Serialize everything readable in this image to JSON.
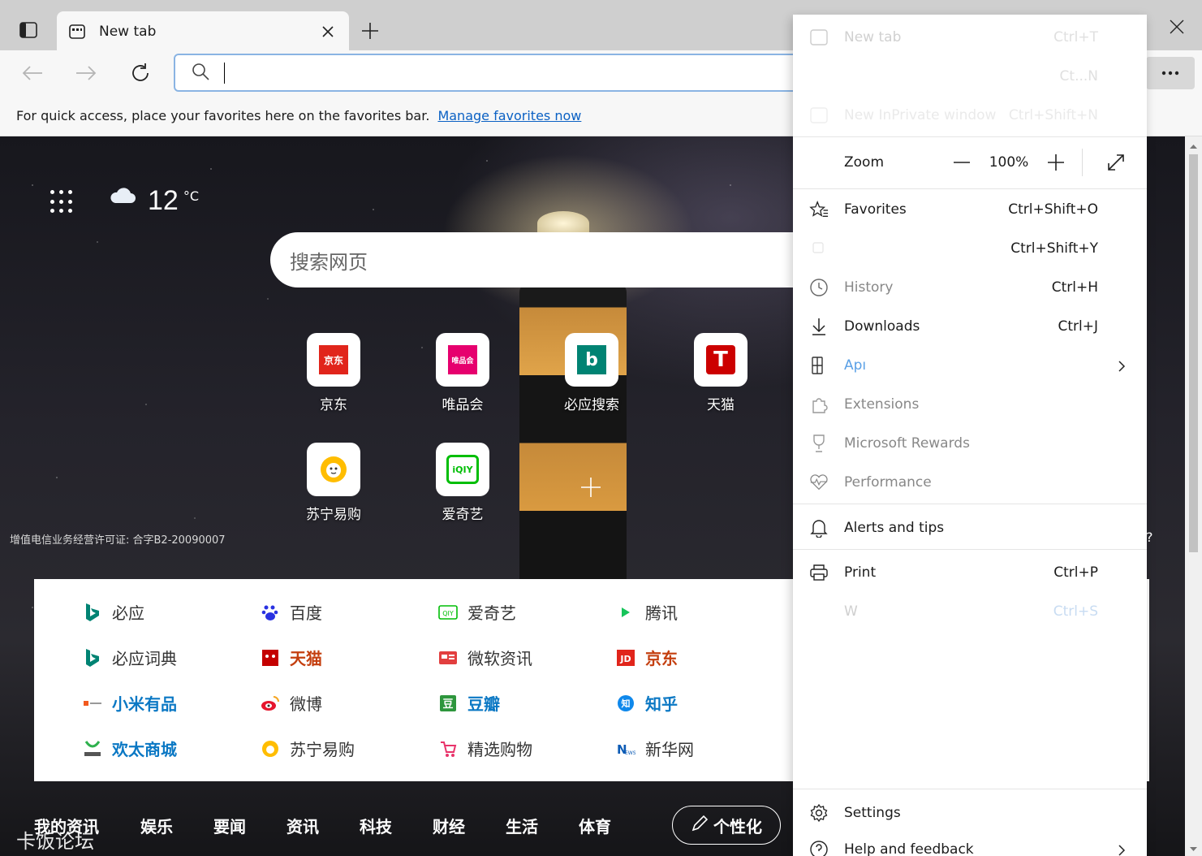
{
  "tab": {
    "title": "New tab"
  },
  "toolbar": {
    "address_placeholder": "",
    "more_label": "···"
  },
  "favorites_bar": {
    "message": "For quick access, place your favorites here on the favorites bar.",
    "link": "Manage favorites now"
  },
  "weather": {
    "temp": "12",
    "unit": "°C"
  },
  "search": {
    "placeholder": "搜索网页"
  },
  "tiles": [
    {
      "label": "京东",
      "icon_text": "京东",
      "color": "#e1251b"
    },
    {
      "label": "唯品会",
      "icon_text": "唯品会",
      "color": "#e6006e"
    },
    {
      "label": "必应搜索",
      "icon_text": "b",
      "color": "#008373"
    },
    {
      "label": "天猫",
      "icon_text": "T",
      "color": "#cc0000"
    },
    {
      "label": "苏宁易购",
      "icon_text": "",
      "color": "#ffbd00"
    },
    {
      "label": "爱奇艺",
      "icon_text": "iQIY",
      "color": "#00be06"
    }
  ],
  "license": "增值电信业务经营许可证: 合字B2-20090007",
  "right_hint": "?",
  "links": [
    {
      "label": "必应",
      "style": "normal",
      "icon": "bing-icon"
    },
    {
      "label": "百度",
      "style": "normal",
      "icon": "baidu-icon"
    },
    {
      "label": "爱奇艺",
      "style": "normal",
      "icon": "iqiyi-icon"
    },
    {
      "label": "腾讯",
      "style": "normal",
      "icon": "tencent-icon"
    },
    {
      "label": "必应词典",
      "style": "normal",
      "icon": "bing-icon"
    },
    {
      "label": "天猫",
      "style": "red",
      "icon": "tmall-icon"
    },
    {
      "label": "微软资讯",
      "style": "normal",
      "icon": "msn-icon"
    },
    {
      "label": "京东",
      "style": "red",
      "icon": "jd-icon"
    },
    {
      "label": "小米有品",
      "style": "blue",
      "icon": "youpin-icon"
    },
    {
      "label": "微博",
      "style": "normal",
      "icon": "weibo-icon"
    },
    {
      "label": "豆瓣",
      "style": "blue",
      "icon": "douban-icon"
    },
    {
      "label": "知乎",
      "style": "blue",
      "icon": "zhihu-icon"
    },
    {
      "label": "欢太商城",
      "style": "blue",
      "icon": "heytap-icon"
    },
    {
      "label": "苏宁易购",
      "style": "normal",
      "icon": "suning-icon"
    },
    {
      "label": "精选购物",
      "style": "normal",
      "icon": "shopping-icon"
    },
    {
      "label": "新华网",
      "style": "normal",
      "icon": "xinhua-icon"
    }
  ],
  "news_tabs": [
    "我的资讯",
    "娱乐",
    "要闻",
    "资讯",
    "科技",
    "财经",
    "生活",
    "体育"
  ],
  "personalize": "个性化",
  "watermark": "卡饭论坛",
  "menu": {
    "new_tab": {
      "label": "New tab",
      "shortcut": "Ctrl+T"
    },
    "new_window": {
      "label": "",
      "shortcut": "Ct...N"
    },
    "new_inprivate": {
      "label": "New InPrivate window",
      "shortcut": "Ctrl+Shift+N"
    },
    "zoom": {
      "label": "Zoom",
      "value": "100%"
    },
    "favorites": {
      "label": "Favorites",
      "shortcut": "Ctrl+Shift+O"
    },
    "collections": {
      "label": "",
      "shortcut": "Ctrl+Shift+Y"
    },
    "history": {
      "label": "History",
      "shortcut": "Ctrl+H"
    },
    "downloads": {
      "label": "Downloads",
      "shortcut": "Ctrl+J"
    },
    "apps": {
      "label": "Apı"
    },
    "extensions": {
      "label": "Extensions"
    },
    "rewards": {
      "label": "Microsoft Rewards"
    },
    "performance": {
      "label": "Performance"
    },
    "alerts": {
      "label": "Alerts and tips"
    },
    "print": {
      "label": "Print",
      "shortcut": "Ctrl+P"
    },
    "web_capture": {
      "label": "W",
      "shortcut": "Ctrl+S"
    },
    "settings": {
      "label": "Settings"
    },
    "help": {
      "label": "Help and feedback"
    }
  }
}
